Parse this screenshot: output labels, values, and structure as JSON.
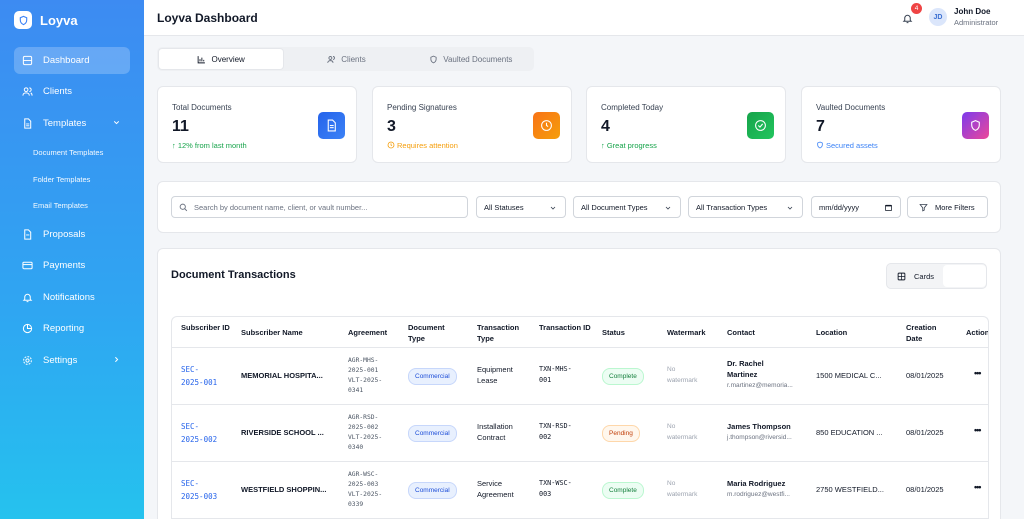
{
  "app": {
    "name": "Loyva"
  },
  "sidebar": {
    "items": [
      {
        "label": "Dashboard"
      },
      {
        "label": "Clients"
      },
      {
        "label": "Templates"
      },
      {
        "label": "Proposals"
      },
      {
        "label": "Payments"
      },
      {
        "label": "Notifications"
      },
      {
        "label": "Reporting"
      },
      {
        "label": "Settings"
      }
    ],
    "template_subitems": [
      {
        "label": "Document Templates"
      },
      {
        "label": "Folder Templates"
      },
      {
        "label": "Email Templates"
      }
    ]
  },
  "header": {
    "title": "Loyva Dashboard",
    "notification_count": "4",
    "user": {
      "initials": "JD",
      "name": "John Doe",
      "role": "Administrator"
    }
  },
  "tabs": [
    {
      "label": "Overview"
    },
    {
      "label": "Clients"
    },
    {
      "label": "Vaulted Documents"
    }
  ],
  "stats": [
    {
      "label": "Total Documents",
      "value": "11",
      "sub": "↑ 12% from last month",
      "color": "#16a34a"
    },
    {
      "label": "Pending Signatures",
      "value": "3",
      "sub": "Requires attention",
      "color": "#f59e0b"
    },
    {
      "label": "Completed Today",
      "value": "4",
      "sub": "↑ Great progress",
      "color": "#16a34a"
    },
    {
      "label": "Vaulted Documents",
      "value": "7",
      "sub": "Secured assets",
      "color": "#3b82f6"
    }
  ],
  "filters": {
    "search_placeholder": "Search by document name, client, or vault number...",
    "status": "All Statuses",
    "doc_type": "All Document Types",
    "txn_type": "All Transaction Types",
    "date_placeholder": "mm/dd/yyyy",
    "more": "More Filters"
  },
  "transactions": {
    "title": "Document Transactions",
    "view_label": "Cards",
    "columns": [
      "Subscriber ID",
      "Subscriber Name",
      "Agreement",
      "Document Type",
      "Transaction Type",
      "Transaction ID",
      "Status",
      "Watermark",
      "Contact",
      "Location",
      "Creation Date",
      "Actions"
    ],
    "rows": [
      {
        "subscriber_id": [
          "SEC-",
          "2025-001"
        ],
        "name": "MEMORIAL HOSPITA...",
        "agreement": [
          "AGR-MHS-",
          "2025-001",
          "VLT-2025-",
          "0341"
        ],
        "doc_type": "Commercial",
        "txn_type": [
          "Equipment",
          "Lease"
        ],
        "txn_id": [
          "TXN-MHS-",
          "001"
        ],
        "status": "Complete",
        "watermark": [
          "No",
          "watermark"
        ],
        "contact_name": [
          "Dr. Rachel",
          "Martinez"
        ],
        "contact_email": "r.martinez@memoria...",
        "location": "1500 MEDICAL C...",
        "date": "08/01/2025"
      },
      {
        "subscriber_id": [
          "SEC-",
          "2025-002"
        ],
        "name": "RIVERSIDE SCHOOL ...",
        "agreement": [
          "AGR-RSD-",
          "2025-002",
          "VLT-2025-",
          "0340"
        ],
        "doc_type": "Commercial",
        "txn_type": [
          "Installation",
          "Contract"
        ],
        "txn_id": [
          "TXN-RSD-",
          "002"
        ],
        "status": "Pending",
        "watermark": [
          "No",
          "watermark"
        ],
        "contact_name": [
          "James Thompson"
        ],
        "contact_email": "j.thompson@riversid...",
        "location": "850 EDUCATION ...",
        "date": "08/01/2025"
      },
      {
        "subscriber_id": [
          "SEC-",
          "2025-003"
        ],
        "name": "WESTFIELD SHOPPIN...",
        "agreement": [
          "AGR-WSC-",
          "2025-003",
          "VLT-2025-",
          "0339"
        ],
        "doc_type": "Commercial",
        "txn_type": [
          "Service",
          "Agreement"
        ],
        "txn_id": [
          "TXN-WSC-",
          "003"
        ],
        "status": "Complete",
        "watermark": [
          "No",
          "watermark"
        ],
        "contact_name": [
          "Maria Rodriguez"
        ],
        "contact_email": "m.rodriguez@westfi...",
        "location": "2750 WESTFIELD...",
        "date": "08/01/2025"
      }
    ]
  },
  "colors": {
    "accent": "#2563eb",
    "complete_bg": "#ecfdf3",
    "complete_fg": "#15803d",
    "complete_border": "#bbf7d0",
    "pending_bg": "#fff7ed",
    "pending_fg": "#c2410c",
    "pending_border": "#fed7aa"
  }
}
